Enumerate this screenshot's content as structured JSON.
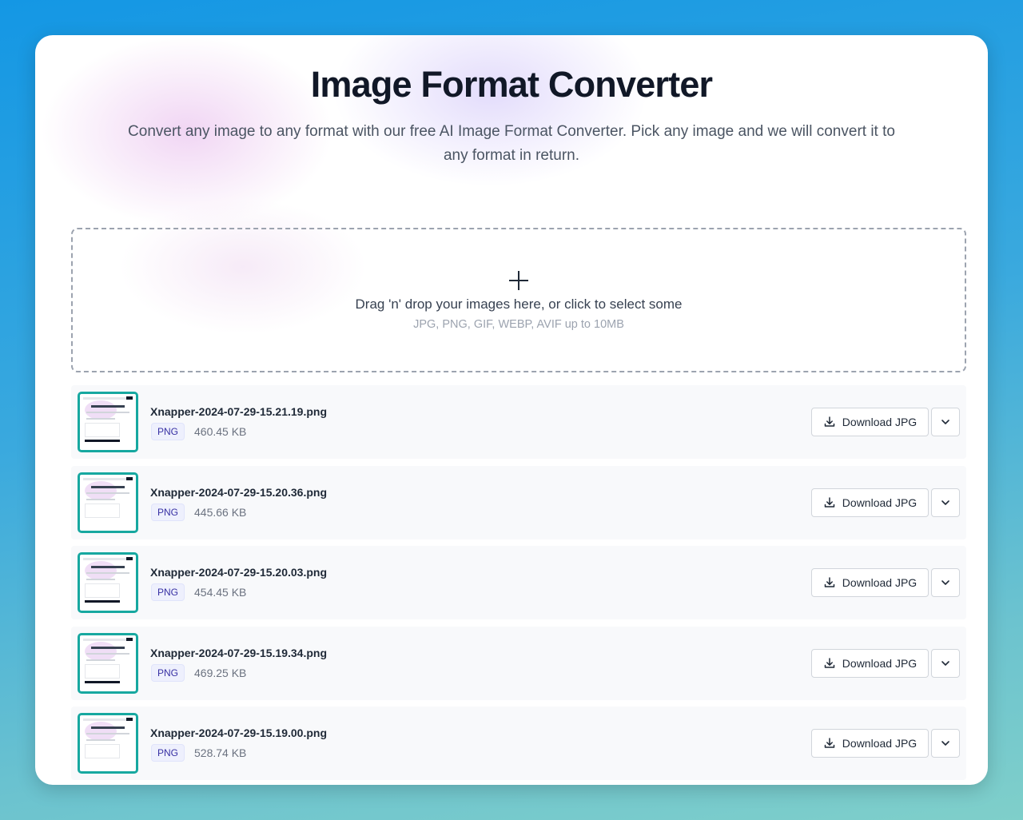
{
  "header": {
    "title": "Image Format Converter",
    "subtitle": "Convert any image to any format with our free AI Image Format Converter. Pick any image and we will convert it to any format in return."
  },
  "dropzone": {
    "icon": "plus-icon",
    "main_text": "Drag 'n' drop your images here, or click to select some",
    "hint_text": "JPG, PNG, GIF, WEBP, AVIF up to 10MB"
  },
  "files": [
    {
      "name": "Xnapper-2024-07-29-15.21.19.png",
      "format": "PNG",
      "size": "460.45 KB",
      "download_label": "Download JPG"
    },
    {
      "name": "Xnapper-2024-07-29-15.20.36.png",
      "format": "PNG",
      "size": "445.66 KB",
      "download_label": "Download JPG"
    },
    {
      "name": "Xnapper-2024-07-29-15.20.03.png",
      "format": "PNG",
      "size": "454.45 KB",
      "download_label": "Download JPG"
    },
    {
      "name": "Xnapper-2024-07-29-15.19.34.png",
      "format": "PNG",
      "size": "469.25 KB",
      "download_label": "Download JPG"
    },
    {
      "name": "Xnapper-2024-07-29-15.19.00.png",
      "format": "PNG",
      "size": "528.74 KB",
      "download_label": "Download JPG"
    }
  ],
  "colors": {
    "thumbnail_border": "#17a8a0",
    "badge_bg": "#eef0fd",
    "badge_text": "#3730a3"
  }
}
